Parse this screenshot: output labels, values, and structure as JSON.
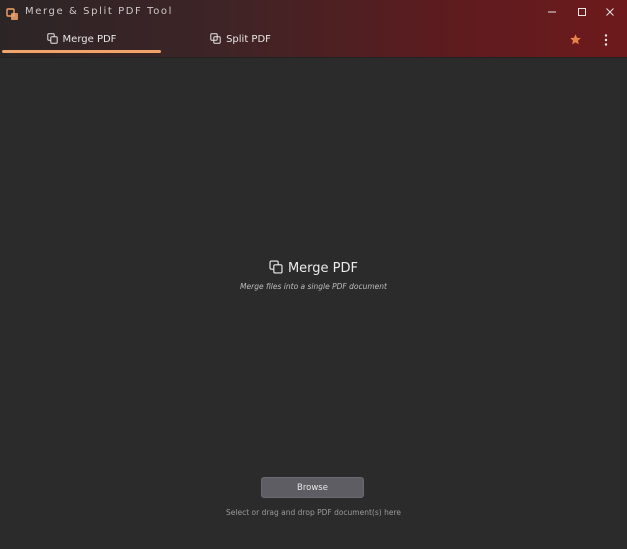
{
  "window": {
    "title": "Merge & Split PDF Tool",
    "accent_color": "#f2a36a",
    "icons": {
      "app": "app-logo-icon",
      "minimize": "minimize-icon",
      "maximize": "maximize-icon",
      "close": "close-icon"
    }
  },
  "tabs": [
    {
      "label": "Merge PDF",
      "icon": "merge-icon",
      "active": true
    },
    {
      "label": "Split PDF",
      "icon": "split-icon",
      "active": false
    }
  ],
  "toolbar": {
    "favorite_icon": "star-icon",
    "favorite_color": "#e9824a",
    "more_icon": "more-vertical-icon"
  },
  "main": {
    "title": "Merge PDF",
    "subtitle": "Merge files into a single PDF document",
    "browse_label": "Browse",
    "drop_hint": "Select or drag and drop PDF document(s) here"
  }
}
